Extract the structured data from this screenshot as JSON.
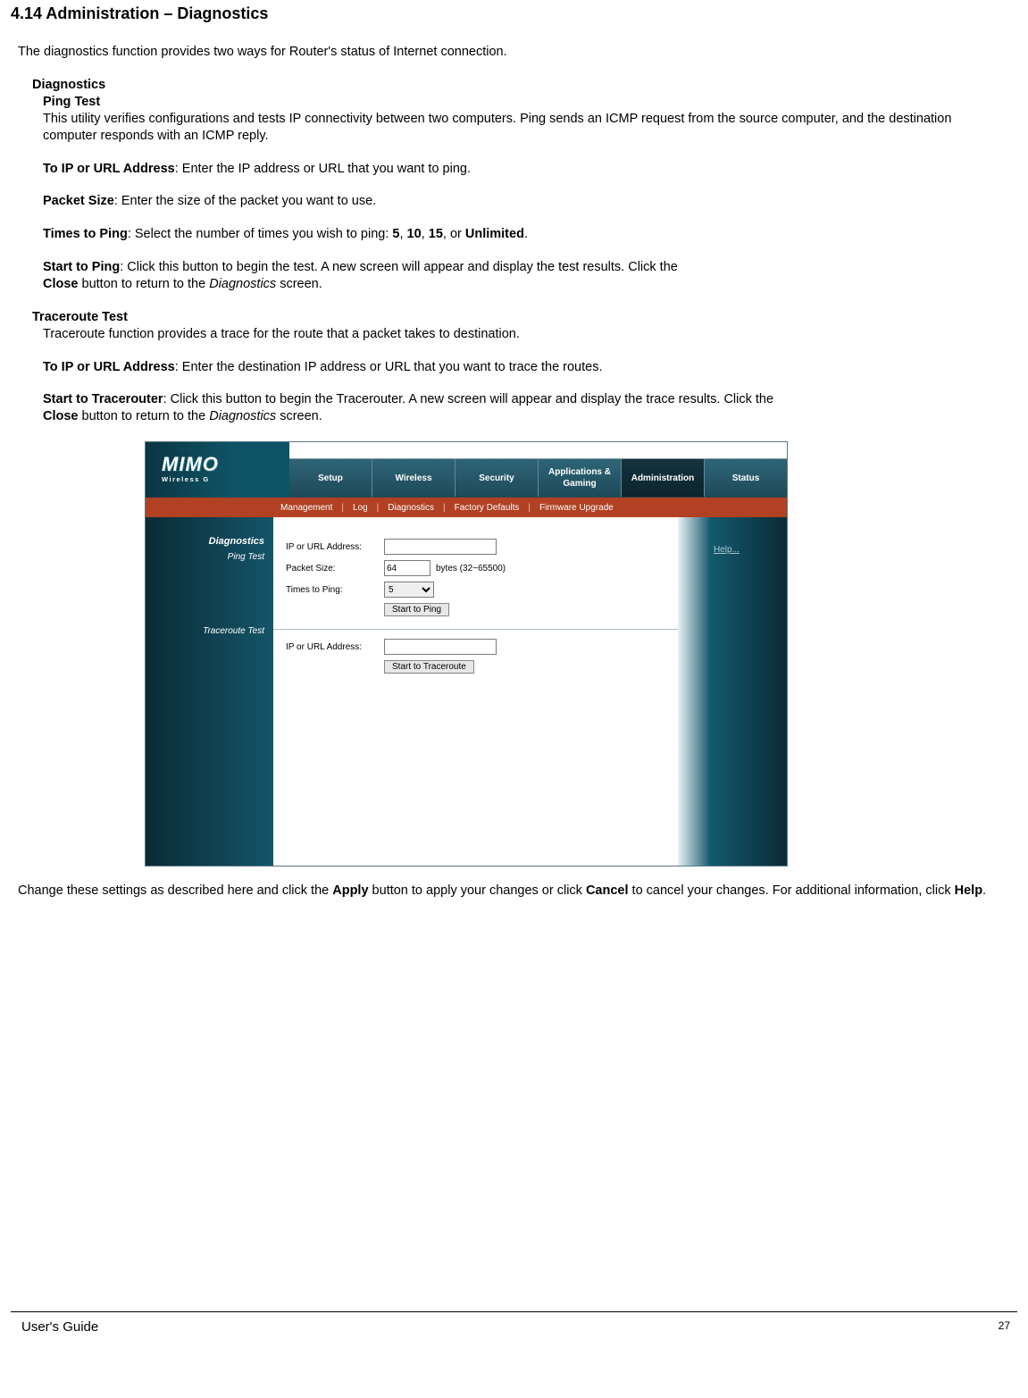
{
  "section_title": "4.14 Administration – Diagnostics",
  "intro": "The diagnostics function provides two ways for Router's status of Internet connection.",
  "diagnostics_heading": "Diagnostics",
  "ping_test": {
    "heading": "Ping Test",
    "desc": "This utility verifies configurations and tests IP connectivity between two computers. Ping sends an ICMP request from the source computer, and the destination computer responds with an ICMP reply.",
    "to_ip_label": "To IP or URL Address",
    "to_ip_text": ": Enter the IP address or URL that you want to ping.",
    "packet_size_label": "Packet Size",
    "packet_size_text": ": Enter the size of the packet you want to use.",
    "times_label": "Times to Ping",
    "times_text_pre": ": Select the number of times you wish to ping: ",
    "times_opts": [
      "5",
      "10",
      "15",
      "Unlimited"
    ],
    "times_sep1": ", ",
    "times_sep2": ", ",
    "times_sep3": ", or ",
    "times_end": ".",
    "start_label": "Start to Ping",
    "start_text": ": Click this button to begin the test. A new screen will appear and display the test results. Click the ",
    "close_label": "Close",
    "close_text_1": " button to return to the ",
    "close_text_italic": "Diagnostics",
    "close_text_2": " screen."
  },
  "traceroute": {
    "heading": "Traceroute Test",
    "desc": "Traceroute function provides a trace for the route that a packet takes to destination.",
    "to_ip_label": "To IP or URL Address",
    "to_ip_text": ": Enter the destination IP address or URL that you want to trace the routes.",
    "start_label": "Start to Tracerouter",
    "start_text": ": Click this button to begin the Tracerouter. A new screen will appear and display the trace results. Click the",
    "close_label": "Close",
    "close_text_1": " button to return to the ",
    "close_text_italic": "Diagnostics",
    "close_text_2": " screen."
  },
  "ui": {
    "logo_main": "MIMO",
    "logo_sub": "Wireless G",
    "tabs": [
      "Setup",
      "Wireless",
      "Security",
      "Applications & Gaming",
      "Administration",
      "Status"
    ],
    "active_tab_index": 4,
    "subnav": [
      "Management",
      "Log",
      "Diagnostics",
      "Factory Defaults",
      "Firmware Upgrade"
    ],
    "side": {
      "diagnostics": "Diagnostics",
      "ping_test": "Ping Test",
      "traceroute_test": "Traceroute Test"
    },
    "form": {
      "ip_label": "IP or URL Address:",
      "packet_label": "Packet Size:",
      "packet_value": "64",
      "packet_suffix": "bytes (32~65500)",
      "times_label": "Times to Ping:",
      "times_value": "5",
      "start_ping_btn": "Start to Ping",
      "ip_label2": "IP or URL Address:",
      "start_trace_btn": "Start to Traceroute"
    },
    "help_link": "Help..."
  },
  "closing": {
    "pre": "Change these settings as described here and click the ",
    "apply": "Apply",
    "mid": " button to apply your changes or click ",
    "cancel": "Cancel",
    "post1": " to cancel your changes. For additional information, click ",
    "help": "Help",
    "post2": "."
  },
  "footer": {
    "left": "User's Guide",
    "right": "27"
  }
}
